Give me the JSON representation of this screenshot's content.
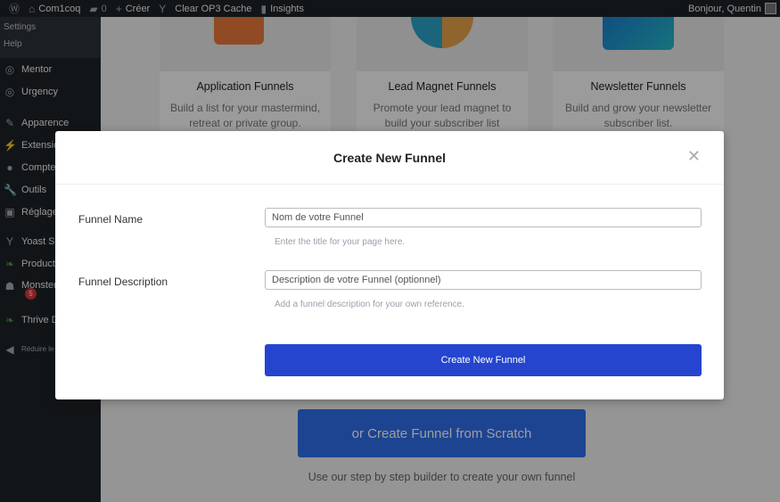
{
  "adminbar": {
    "site": "Com1coq",
    "comments": "0",
    "create": "Créer",
    "cache": "Clear OP3 Cache",
    "insights": "Insights",
    "greeting": "Bonjour, Quentin"
  },
  "sidebar": {
    "submenu": [
      "Settings",
      "Help"
    ],
    "items": [
      {
        "label": "Mentor",
        "icon": "rocket-icon"
      },
      {
        "label": "Urgency",
        "icon": "rocket-icon"
      },
      {
        "label": "Apparence",
        "icon": "paintbrush-icon"
      },
      {
        "label": "Extensions",
        "icon": "plugin-icon"
      },
      {
        "label": "Comptes",
        "icon": "user-icon"
      },
      {
        "label": "Outils",
        "icon": "wrench-icon"
      },
      {
        "label": "Réglages",
        "icon": "settings-icon"
      },
      {
        "label": "Yoast SEO",
        "icon": "yoast-icon"
      },
      {
        "label": "Product",
        "icon": "leaf-icon"
      },
      {
        "label": "Monster",
        "icon": "monster-icon"
      },
      {
        "label": "Thrive D",
        "icon": "leaf-icon"
      },
      {
        "label": "Réduire le menu",
        "icon": "collapse-icon"
      }
    ],
    "badge": "5"
  },
  "cards": [
    {
      "title": "Application Funnels",
      "desc": "Build a list for your mastermind, retreat or private group."
    },
    {
      "title": "Lead Magnet Funnels",
      "desc": "Promote your lead magnet to build your subscriber list"
    },
    {
      "title": "Newsletter Funnels",
      "desc": "Build and grow your newsletter subscriber list."
    }
  ],
  "scratch": {
    "button": "or Create Funnel from Scratch",
    "caption": "Use our step by step builder to create your own funnel"
  },
  "modal": {
    "title": "Create New Funnel",
    "name_label": "Funnel Name",
    "name_placeholder": "Nom de votre Funnel",
    "name_help": "Enter the title for your page here.",
    "desc_label": "Funnel Description",
    "desc_placeholder": "Description de votre Funnel (optionnel)",
    "desc_help": "Add a funnel description for your own reference.",
    "submit": "Create New Funnel"
  },
  "colors": {
    "accent": "#2545cf",
    "adminbar": "#1d2327"
  }
}
